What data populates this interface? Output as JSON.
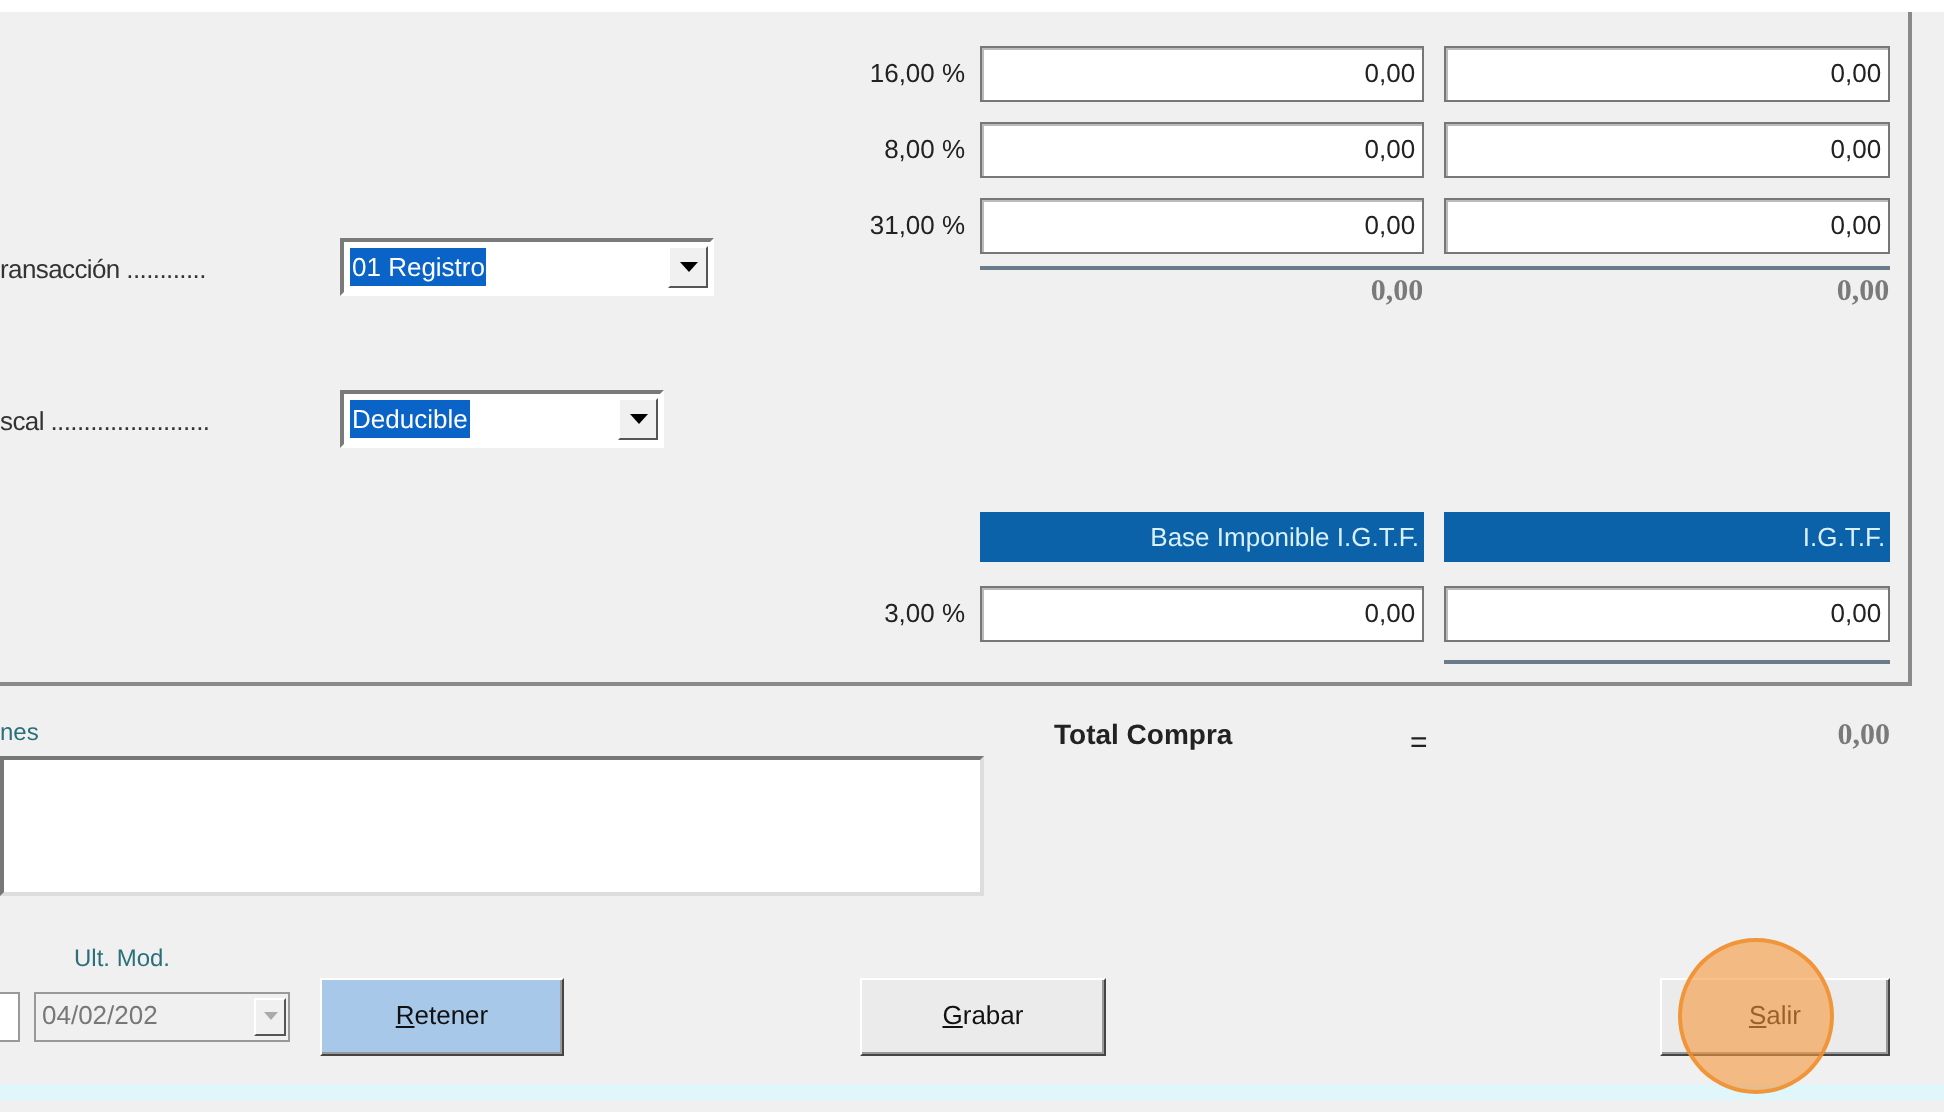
{
  "tax_rows": [
    {
      "rate": "16,00 %",
      "base": "0,00",
      "tax": "0,00"
    },
    {
      "rate": "8,00 %",
      "base": "0,00",
      "tax": "0,00"
    },
    {
      "rate": "31,00 %",
      "base": "0,00",
      "tax": "0,00"
    }
  ],
  "totals": {
    "base": "0,00",
    "tax": "0,00"
  },
  "fields": [
    {
      "label": "ransacción ............",
      "value": "01 Registro",
      "text_selected": true
    },
    {
      "label": "scal ........................",
      "value": "Deducible",
      "text_selected": true
    }
  ],
  "igtf": {
    "headers": [
      "Base Imponible I.G.T.F.",
      "I.G.T.F."
    ],
    "rate": "3,00 %",
    "base": "0,00",
    "tax": "0,00"
  },
  "notes": {
    "label": "nes"
  },
  "total": {
    "label": "Total Compra",
    "equals": "=",
    "value": "0,00"
  },
  "last_modified": {
    "label": "Ult. Mod.",
    "value": "04/02/202",
    "disabled": true
  },
  "buttons": [
    {
      "label": "Retener",
      "focused": true,
      "click_marker": false
    },
    {
      "label": "Grabar",
      "focused": false,
      "click_marker": false
    },
    {
      "label": "Salir",
      "focused": false,
      "click_marker": true
    }
  ]
}
